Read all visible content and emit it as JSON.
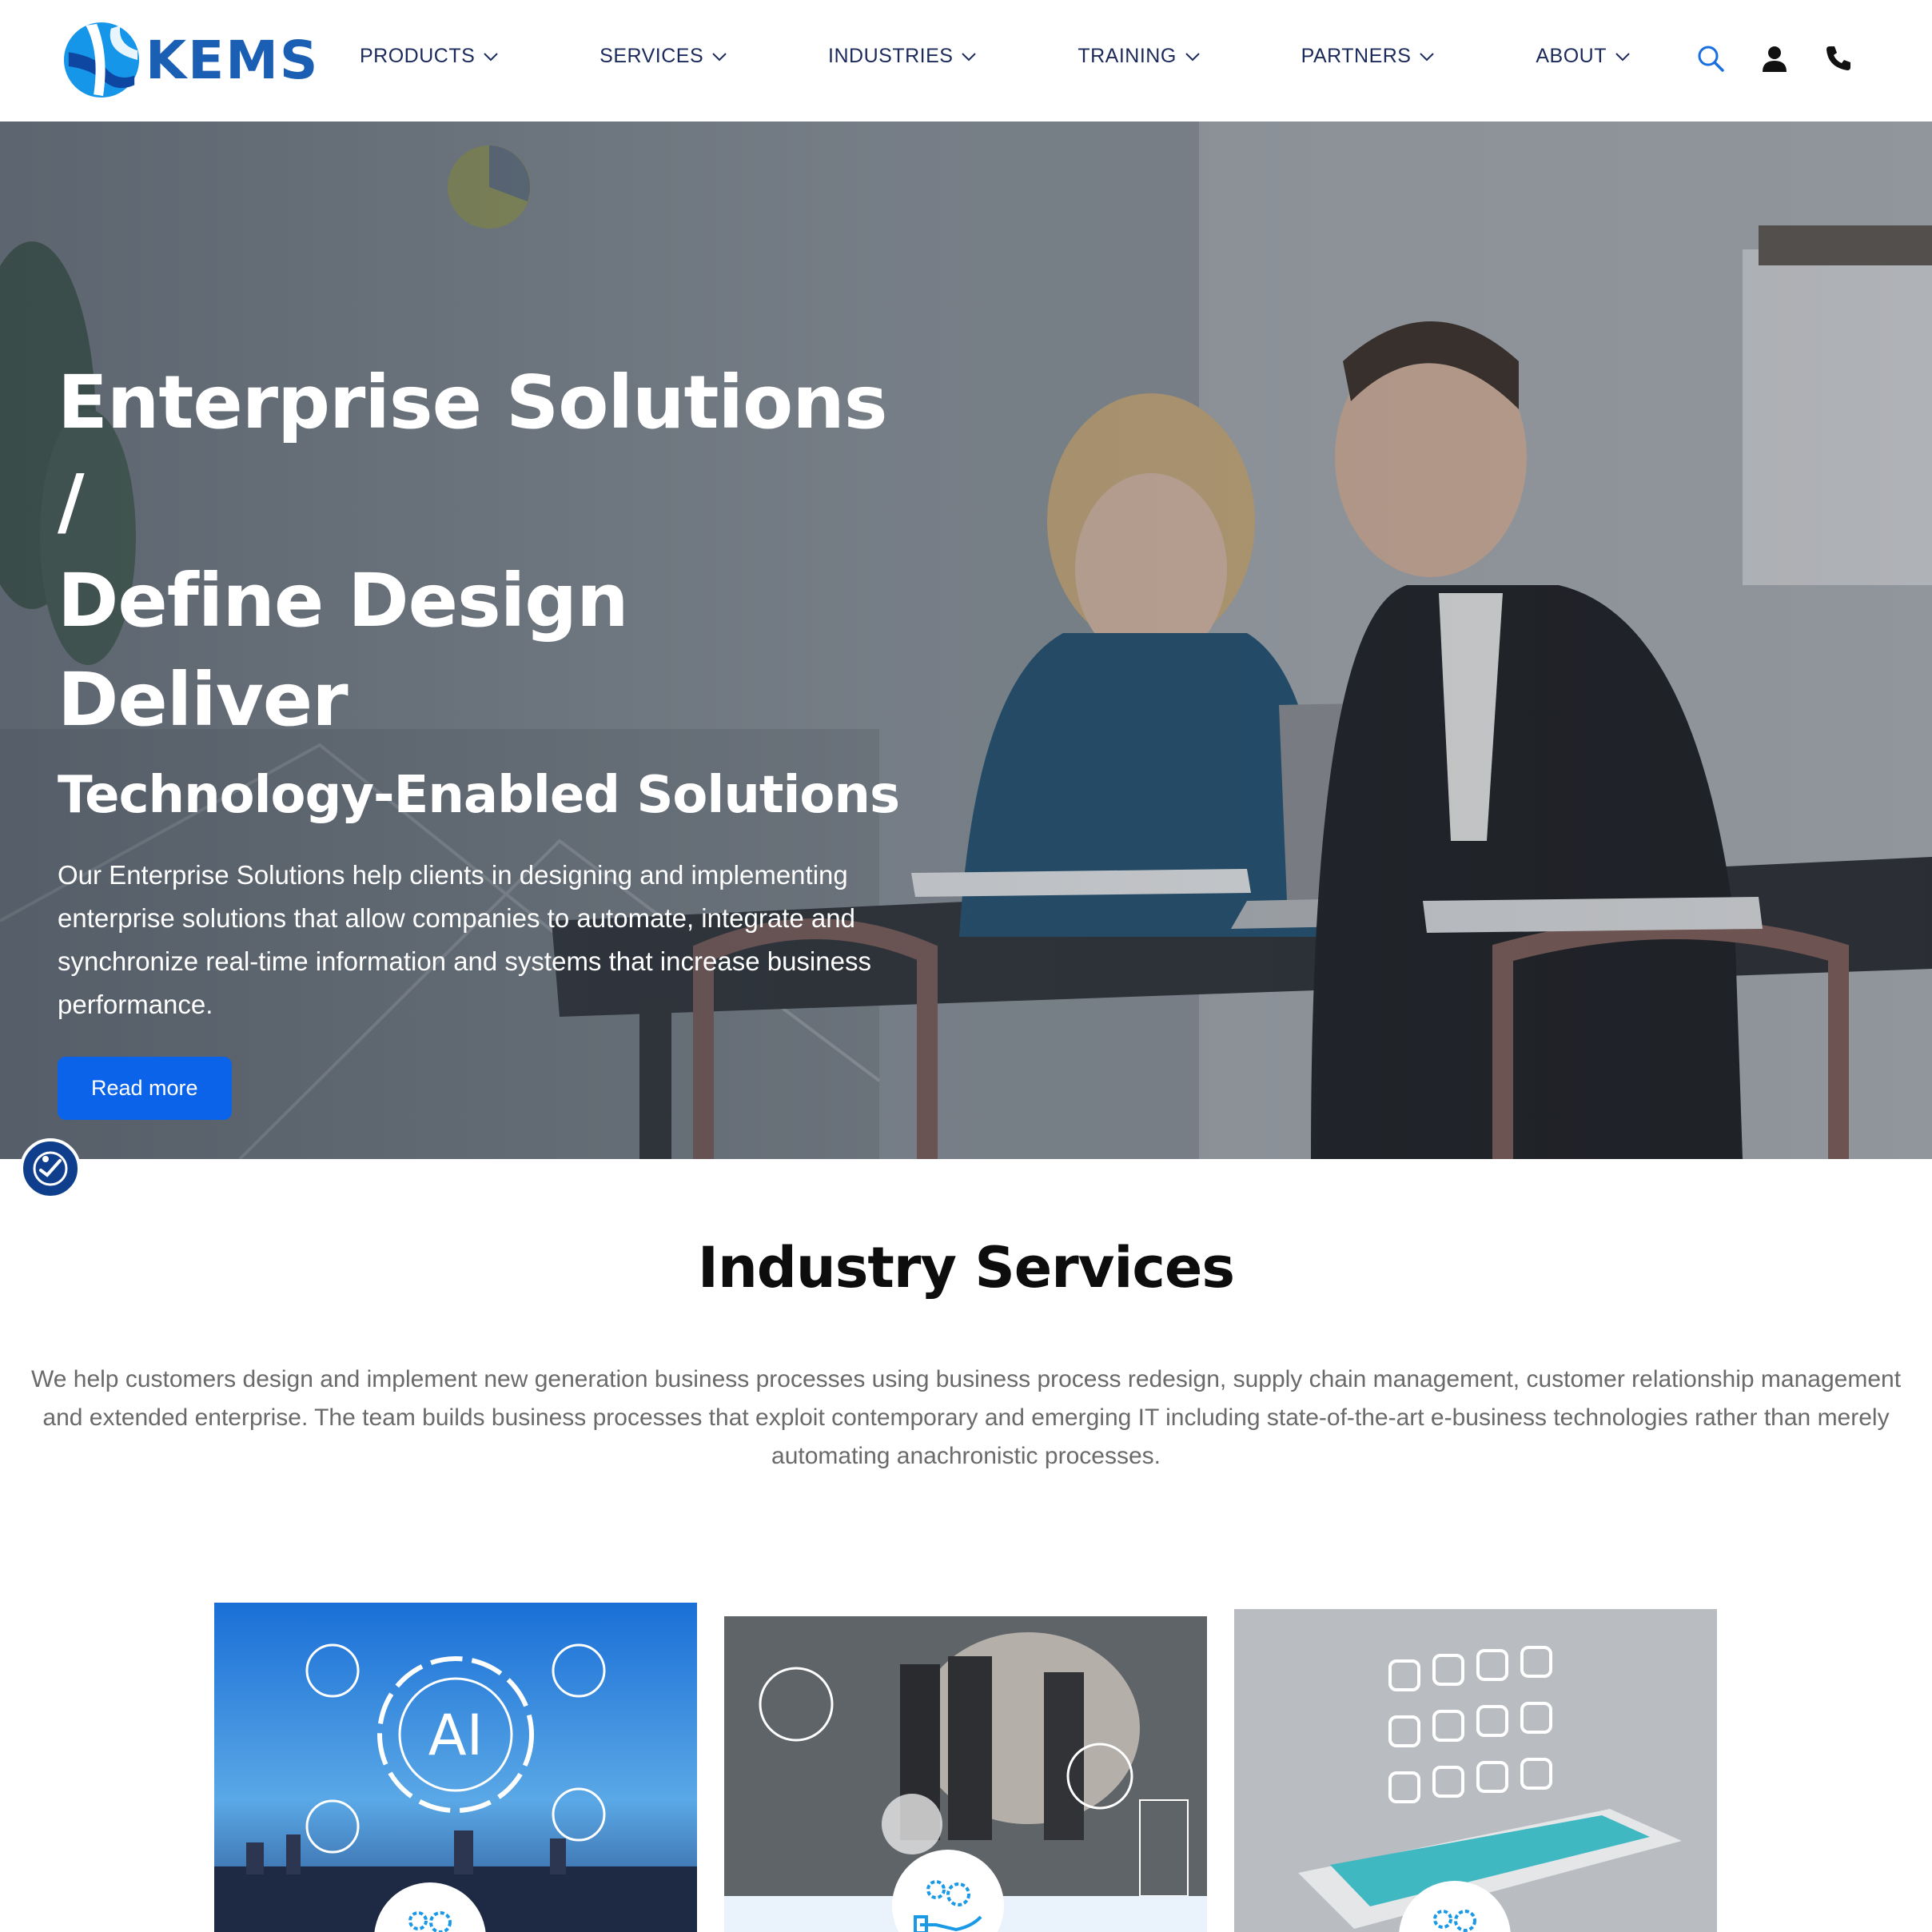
{
  "brand": {
    "name": "KEMS",
    "color": "#1a5fb4"
  },
  "nav": {
    "items": [
      {
        "label": "PRODUCTS"
      },
      {
        "label": "SERVICES"
      },
      {
        "label": "INDUSTRIES"
      },
      {
        "label": "TRAINING"
      },
      {
        "label": "PARTNERS"
      },
      {
        "label": "ABOUT"
      }
    ],
    "icons": [
      "search-icon",
      "user-icon",
      "phone-icon"
    ]
  },
  "hero": {
    "title_line1": "Enterprise Solutions /",
    "title_line2": "Define Design Deliver",
    "subtitle": "Technology-Enabled Solutions",
    "description": "Our Enterprise Solutions help clients in designing and implementing enterprise solutions that allow companies to automate, integrate and synchronize real-time information and systems that increase business performance.",
    "button_label": "Read more",
    "button_color": "#0b63ea"
  },
  "services": {
    "title": "Industry Services",
    "description": "We help customers design and implement new generation business processes using business process redesign, supply chain management, customer relationship management and extended enterprise. The team builds business processes that exploit contemporary and emerging IT including state-of-the-art e-business technologies rather than merely automating anachronistic processes.",
    "cards": [
      {
        "image": "ai-city-image",
        "icon": "gears-icon",
        "label": "AI"
      },
      {
        "image": "business-analytics-image",
        "icon": "gear-hand-icon"
      },
      {
        "image": "mobile-apps-image",
        "icon": "gears-icon"
      }
    ]
  }
}
